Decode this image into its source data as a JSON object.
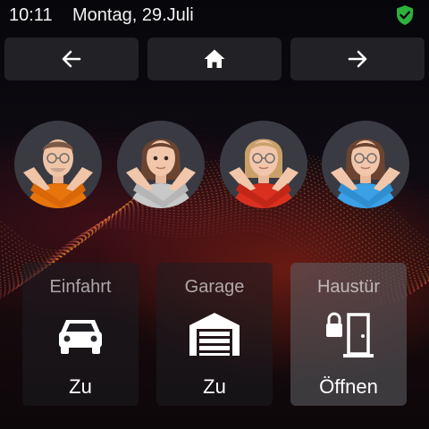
{
  "status_bar": {
    "time": "10:11",
    "date": "Montag, 29.Juli",
    "security_icon": "shield-check-icon",
    "security_color": "#2eb13c"
  },
  "nav": {
    "back_icon": "arrow-left-icon",
    "home_icon": "home-icon",
    "forward_icon": "arrow-right-icon"
  },
  "avatars": [
    {
      "icon": "memoji-man-glasses-orange-shirt",
      "shirt_color": "#e8740c"
    },
    {
      "icon": "memoji-woman-brown-hair-grey-shirt",
      "shirt_color": "#c8c8c8"
    },
    {
      "icon": "memoji-woman-blonde-red-shirt",
      "shirt_color": "#d9301f"
    },
    {
      "icon": "memoji-woman-glasses-blue-shirt",
      "shirt_color": "#3ba0e6"
    }
  ],
  "tiles": [
    {
      "title": "Einfahrt",
      "icon": "car-icon",
      "status": "Zu"
    },
    {
      "title": "Garage",
      "icon": "garage-icon",
      "status": "Zu"
    },
    {
      "title": "Haustür",
      "icon": "door-lock-icon",
      "status": "Öffnen"
    }
  ]
}
